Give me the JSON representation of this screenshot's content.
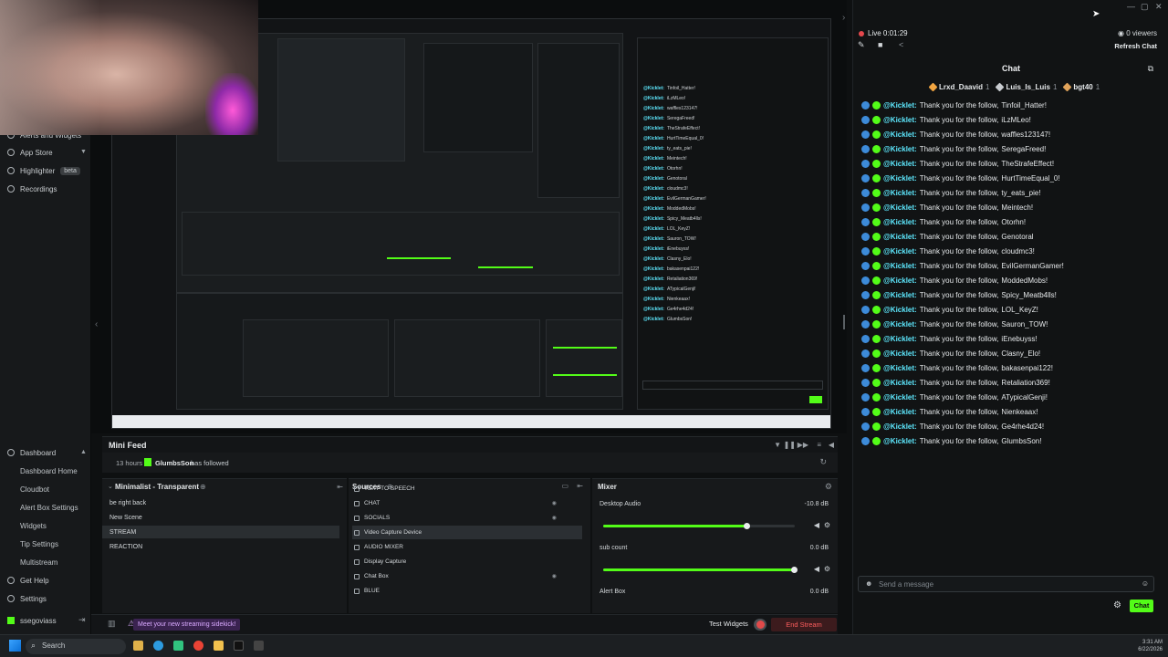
{
  "sidebar": {
    "top_items": [
      {
        "label": "Alerts and Widgets",
        "icon": "widget-icon"
      },
      {
        "label": "App Store",
        "icon": "store-icon"
      },
      {
        "label": "Highlighter",
        "badge": "beta",
        "icon": "highlighter-icon"
      },
      {
        "label": "Recordings",
        "icon": "recordings-icon"
      }
    ],
    "dashboard": {
      "label": "Dashboard",
      "items": [
        "Dashboard Home",
        "Cloudbot",
        "Alert Box Settings",
        "Widgets",
        "Tip Settings",
        "Multistream"
      ]
    },
    "bottom_items": [
      {
        "label": "Get Help",
        "icon": "help-icon"
      },
      {
        "label": "Settings",
        "icon": "gear-icon"
      }
    ],
    "user": "ssegoviass"
  },
  "mini_feed": {
    "title": "Mini Feed",
    "time": "13 hours",
    "user": "GlumbsSon",
    "action": "has followed"
  },
  "scenes": {
    "title": "Minimalist - Transparent",
    "items": [
      "be right back",
      "New Scene",
      "STREAM",
      "REACTION"
    ],
    "selected": 2
  },
  "sources": {
    "title": "Sources",
    "items": [
      {
        "label": "TEXT TO SPEECH"
      },
      {
        "label": "CHAT"
      },
      {
        "label": "SOCIALS"
      },
      {
        "label": "Video Capture Device"
      },
      {
        "label": "AUDIO MIXER"
      },
      {
        "label": "Display Capture"
      },
      {
        "label": "Chat Box"
      },
      {
        "label": "BLUE"
      }
    ],
    "selected": 3
  },
  "mixer": {
    "title": "Mixer",
    "channels": [
      {
        "label": "Desktop Audio",
        "db": "-10.8 dB",
        "level": 0.75
      },
      {
        "label": "sub count",
        "db": "0.0 dB",
        "level": 1.0
      },
      {
        "label": "Alert Box",
        "db": "0.0 dB",
        "level": 1.0
      }
    ]
  },
  "statusbar": {
    "sidekick": "Meet your new streaming sidekick!",
    "test_widgets": "Test Widgets",
    "end_stream": "End Stream"
  },
  "chat": {
    "live": "Live 0:01:29",
    "viewers": "0 viewers",
    "refresh": "Refresh Chat",
    "title": "Chat",
    "top_users": [
      {
        "name": "Lrxd_Daavid",
        "count": "1",
        "color": "#f2a541"
      },
      {
        "name": "Luis_Is_Luis",
        "count": "1",
        "color": "#c8ccd0"
      },
      {
        "name": "bgt40",
        "count": "1",
        "color": "#e0a35a"
      }
    ],
    "bot": "@Kicklet:",
    "message_prefix": "Thank you for the follow,",
    "followers": [
      "Tinfoil_Hatter!",
      "iLzMLeo!",
      "waffles123147!",
      "SeregaFreed!",
      "TheStrafeEffect!",
      "HurtTimeEqual_0!",
      "ty_eats_pie!",
      "Meintech!",
      "Otorhn!",
      "Genotoral",
      "cloudmc3!",
      "EvilGermanGamer!",
      "ModdedMobs!",
      "Spicy_Meatb4lls!",
      "LOL_KeyZ!",
      "Sauron_TOW!",
      "iEnebuyss!",
      "Clasny_Elo!",
      "bakasenpai122!",
      "Retaliation369!",
      "ATypicalGenji!",
      "Nienkeaax!",
      "Ge4rhe4d24!",
      "GlumbsSon!"
    ],
    "send_placeholder": "Send a message",
    "chat_button": "Chat"
  },
  "taskbar": {
    "search": "Search",
    "time": "3:31 AM",
    "date": "6/22/2026"
  },
  "colors": {
    "accent": "#53fc18",
    "username": "#5ee9ff",
    "end_stream": "#ff5e5e"
  }
}
